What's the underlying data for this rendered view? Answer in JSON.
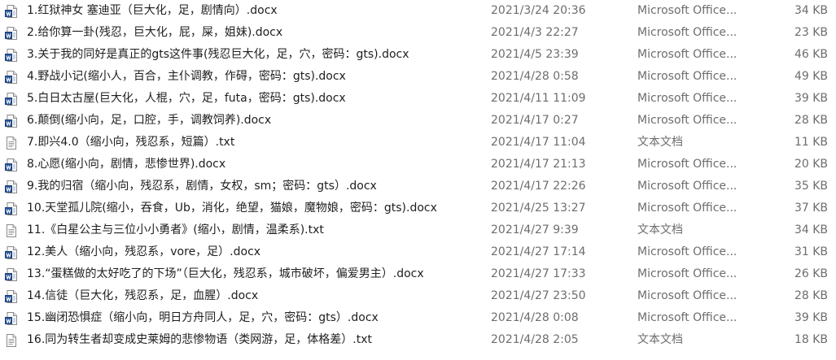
{
  "files": [
    {
      "icon": "word-doc-icon",
      "name": "1.红狱神女 塞迪亚（巨大化，足，剧情向）.docx",
      "date": "2021/3/24 20:36",
      "type": "Microsoft Office...",
      "size": "34 KB"
    },
    {
      "icon": "word-doc-icon",
      "name": "2.给你算一卦(残忍，巨大化，屁，屎，姐妹).docx",
      "date": "2021/4/3 22:27",
      "type": "Microsoft Office...",
      "size": "23 KB"
    },
    {
      "icon": "word-doc-icon",
      "name": "3.关于我的同好是真正的gts这件事(残忍巨大化，足，穴，密码：gts).docx",
      "date": "2021/4/5 23:39",
      "type": "Microsoft Office...",
      "size": "46 KB"
    },
    {
      "icon": "word-doc-icon",
      "name": "4.野战小记(缩小人，百合，主仆调教，作碍，密码：gts).docx",
      "date": "2021/4/28 0:58",
      "type": "Microsoft Office...",
      "size": "49 KB"
    },
    {
      "icon": "word-doc-icon",
      "name": "5.白日太古屋(巨大化，人棍，穴，足，futa，密码：gts).docx",
      "date": "2021/4/11 11:09",
      "type": "Microsoft Office...",
      "size": "39 KB"
    },
    {
      "icon": "word-doc-icon",
      "name": "6.颠倒(缩小向，足，口腔，手，调教饲养).docx",
      "date": "2021/4/17 0:27",
      "type": "Microsoft Office...",
      "size": "28 KB"
    },
    {
      "icon": "text-doc-icon",
      "name": "7.即兴4.0（缩小向，残忍系，短篇）.txt",
      "date": "2021/4/17 11:04",
      "type": "文本文档",
      "size": "11 KB"
    },
    {
      "icon": "word-doc-icon",
      "name": "8.心愿(缩小向，剧情，悲惨世界).docx",
      "date": "2021/4/17 21:13",
      "type": "Microsoft Office...",
      "size": "20 KB"
    },
    {
      "icon": "word-doc-icon",
      "name": "9.我的归宿（缩小向，残忍系，剧情，女权，sm；密码：gts）.docx",
      "date": "2021/4/17 22:26",
      "type": "Microsoft Office...",
      "size": "35 KB"
    },
    {
      "icon": "word-doc-icon",
      "name": "10.天堂孤儿院(缩小，吞食，Ub，消化，绝望，猫娘，魔物娘，密码：gts).docx",
      "date": "2021/4/25 13:27",
      "type": "Microsoft Office...",
      "size": "37 KB"
    },
    {
      "icon": "text-doc-icon",
      "name": "11.《白星公主与三位小小勇者》(缩小，剧情，温柔系).txt",
      "date": "2021/4/27 9:39",
      "type": "文本文档",
      "size": "34 KB"
    },
    {
      "icon": "word-doc-icon",
      "name": "12.美人（缩小向，残忍系，vore，足）.docx",
      "date": "2021/4/27 17:14",
      "type": "Microsoft Office...",
      "size": "31 KB"
    },
    {
      "icon": "word-doc-icon",
      "name": "13.“蛋糕做的太好吃了的下场”（巨大化，残忍系，城市破坏，偏爱男主）.docx",
      "date": "2021/4/27 17:33",
      "type": "Microsoft Office...",
      "size": "26 KB"
    },
    {
      "icon": "word-doc-icon",
      "name": "14.信徒（巨大化，残忍系，足，血腥）.docx",
      "date": "2021/4/27 23:50",
      "type": "Microsoft Office...",
      "size": "28 KB"
    },
    {
      "icon": "word-doc-icon",
      "name": "15.幽闭恐惧症（缩小向，明日方舟同人，足，穴，密码：gts）.docx",
      "date": "2021/4/28 0:08",
      "type": "Microsoft Office...",
      "size": "39 KB"
    },
    {
      "icon": "text-doc-icon",
      "name": "16.同为转生者却变成史莱姆的悲惨物语（类网游，足，体格差）.txt",
      "date": "2021/4/28 2:05",
      "type": "文本文档",
      "size": "18 KB"
    }
  ],
  "colors": {
    "word_icon_blue": "#2b579a",
    "text_secondary": "#6d6d6d",
    "text_primary": "#1e1e1e"
  }
}
